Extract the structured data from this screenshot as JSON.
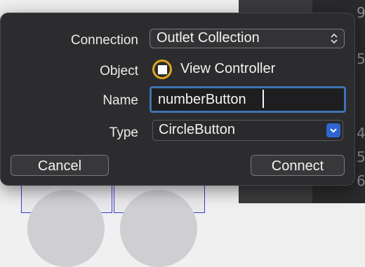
{
  "dialog": {
    "connection": {
      "label": "Connection",
      "value": "Outlet Collection"
    },
    "object": {
      "label": "Object",
      "value": "View Controller"
    },
    "name": {
      "label": "Name",
      "value": "numberButton"
    },
    "type": {
      "label": "Type",
      "value": "CircleButton"
    },
    "buttons": {
      "cancel": "Cancel",
      "connect": "Connect"
    }
  },
  "background": {
    "edge_digits": [
      "9",
      "5",
      "4",
      "5",
      "6"
    ]
  },
  "colors": {
    "dialog_bg": "#2c2c2e",
    "focus_ring": "#3f73b0",
    "object_ring": "#e0a71a",
    "type_chevron": "#2f65d2"
  },
  "icons": [
    "updown-chevron-icon",
    "object-radio-icon",
    "chevron-down-icon"
  ]
}
